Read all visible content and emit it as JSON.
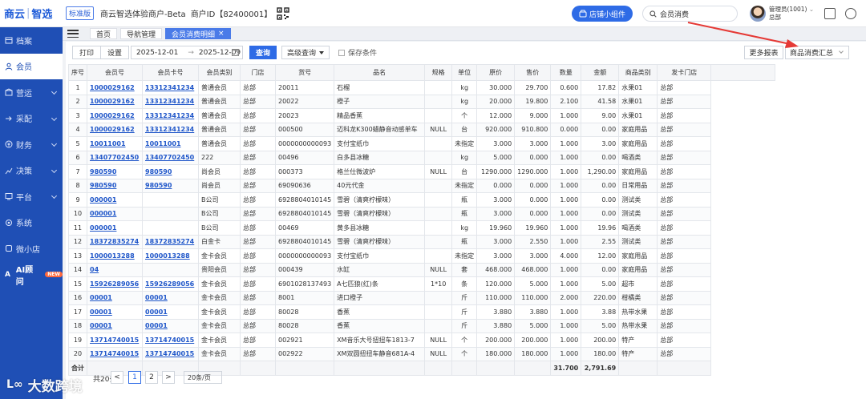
{
  "header": {
    "logo_a": "商云",
    "logo_b": "智选",
    "edition": "标准版",
    "merchant": "商云智选体验商户-Beta",
    "merchant_id": "商户ID【82400001】",
    "widget_label": "店铺小组件",
    "search_value": "会员消费",
    "user_name": "管理员(1001)",
    "user_store": "总部"
  },
  "sidebar": {
    "items": [
      {
        "label": "档案",
        "icon": "archive-icon",
        "chevron": false
      },
      {
        "label": "会员",
        "icon": "member-icon",
        "chevron": false,
        "active": true
      },
      {
        "label": "营运",
        "icon": "operation-icon",
        "chevron": true
      },
      {
        "label": "采配",
        "icon": "purchase-icon",
        "chevron": true
      },
      {
        "label": "财务",
        "icon": "finance-icon",
        "chevron": true
      },
      {
        "label": "决策",
        "icon": "decision-icon",
        "chevron": true
      },
      {
        "label": "平台",
        "icon": "platform-icon",
        "chevron": true
      },
      {
        "label": "系统",
        "icon": "system-icon",
        "chevron": false
      },
      {
        "label": "微小店",
        "icon": "mini-shop-icon",
        "chevron": false
      },
      {
        "label": "AI顾问",
        "icon": "ai-icon",
        "chevron": false,
        "badge": "NEW"
      }
    ]
  },
  "tabs": [
    {
      "label": "首页",
      "active": false,
      "closable": false
    },
    {
      "label": "导航管理",
      "active": false,
      "closable": false
    },
    {
      "label": "会员消费明细",
      "active": true,
      "closable": true
    }
  ],
  "toolbar": {
    "print": "打印",
    "settings": "设置",
    "date_from": "2025-12-01",
    "date_arrow": "→",
    "date_to": "2025-12-09",
    "query": "查询",
    "advanced": "高级查询",
    "save_condition": "保存条件",
    "more_reports": "更多报表",
    "report_select": "商品消费汇总"
  },
  "table": {
    "columns": [
      "序号",
      "会员号",
      "会员卡号",
      "会员类别",
      "门店",
      "货号",
      "品名",
      "规格",
      "单位",
      "原价",
      "售价",
      "数量",
      "金额",
      "商品类别",
      "发卡门店"
    ],
    "rows": [
      [
        "1",
        "1000029162",
        "13312341234",
        "普通会员",
        "总部",
        "20011",
        "石榴",
        "",
        "kg",
        "30.000",
        "29.700",
        "0.600",
        "17.82",
        "水果01",
        "总部"
      ],
      [
        "2",
        "1000029162",
        "13312341234",
        "普通会员",
        "总部",
        "20022",
        "橙子",
        "",
        "kg",
        "20.000",
        "19.800",
        "2.100",
        "41.58",
        "水果01",
        "总部"
      ],
      [
        "3",
        "1000029162",
        "13312341234",
        "普通会员",
        "总部",
        "20023",
        "精品香蕉",
        "",
        "个",
        "12.000",
        "9.000",
        "1.000",
        "9.00",
        "水果01",
        "总部"
      ],
      [
        "4",
        "1000029162",
        "13312341234",
        "普通会员",
        "总部",
        "000500",
        "迈科龙K300蜡静音动感单车",
        "NULL",
        "台",
        "920.000",
        "910.800",
        "0.000",
        "0.00",
        "家庭用品",
        "总部"
      ],
      [
        "5",
        "10011001",
        "10011001",
        "普通会员",
        "总部",
        "0000000000093",
        "支付宝纸巾",
        "",
        "未指定",
        "3.000",
        "3.000",
        "1.000",
        "3.00",
        "家庭用品",
        "总部"
      ],
      [
        "6",
        "13407702450",
        "13407702450",
        "222",
        "总部",
        "00496",
        "白多县冰糖",
        "",
        "kg",
        "5.000",
        "0.000",
        "1.000",
        "0.00",
        "喝酒类",
        "总部"
      ],
      [
        "7",
        "980590",
        "980590",
        "尚会员",
        "总部",
        "000373",
        "格兰仕微波炉",
        "NULL",
        "台",
        "1290.000",
        "1290.000",
        "1.000",
        "1,290.00",
        "家庭用品",
        "总部"
      ],
      [
        "8",
        "980590",
        "980590",
        "尚会员",
        "总部",
        "69090636",
        "40元代金",
        "",
        "未指定",
        "0.000",
        "0.000",
        "1.000",
        "0.00",
        "日常用品",
        "总部"
      ],
      [
        "9",
        "000001",
        "",
        "B公司",
        "总部",
        "6928804010145",
        "雪碧（清爽柠檬味）",
        "",
        "瓶",
        "3.000",
        "0.000",
        "1.000",
        "0.00",
        "测试类",
        "总部"
      ],
      [
        "10",
        "000001",
        "",
        "B公司",
        "总部",
        "6928804010145",
        "雪碧（清爽柠檬味）",
        "",
        "瓶",
        "3.000",
        "0.000",
        "1.000",
        "0.00",
        "测试类",
        "总部"
      ],
      [
        "11",
        "000001",
        "",
        "B公司",
        "总部",
        "00469",
        "黄多县冰糖",
        "",
        "kg",
        "19.960",
        "19.960",
        "1.000",
        "19.96",
        "喝酒类",
        "总部"
      ],
      [
        "12",
        "18372835274",
        "18372835274",
        "白金卡",
        "总部",
        "6928804010145",
        "雪碧（清爽柠檬味）",
        "",
        "瓶",
        "3.000",
        "2.550",
        "1.000",
        "2.55",
        "测试类",
        "总部"
      ],
      [
        "13",
        "1000013288",
        "1000013288",
        "金卡会员",
        "总部",
        "0000000000093",
        "支付宝纸巾",
        "",
        "未指定",
        "3.000",
        "3.000",
        "4.000",
        "12.00",
        "家庭用品",
        "总部"
      ],
      [
        "14",
        "04",
        "",
        "贵阳会员",
        "总部",
        "000439",
        "水缸",
        "NULL",
        "套",
        "468.000",
        "468.000",
        "1.000",
        "0.00",
        "家庭用品",
        "总部"
      ],
      [
        "15",
        "15926289056",
        "15926289056",
        "金卡会员",
        "总部",
        "6901028137493",
        "A七匹狼(红)条",
        "1*10",
        "条",
        "120.000",
        "5.000",
        "1.000",
        "5.00",
        "超市",
        "总部"
      ],
      [
        "16",
        "00001",
        "00001",
        "金卡会员",
        "总部",
        "8001",
        "进口橙子",
        "",
        "斤",
        "110.000",
        "110.000",
        "2.000",
        "220.00",
        "柑橘类",
        "总部"
      ],
      [
        "17",
        "00001",
        "00001",
        "金卡会员",
        "总部",
        "80028",
        "香蕉",
        "",
        "斤",
        "3.880",
        "3.880",
        "1.000",
        "3.88",
        "热带水果",
        "总部"
      ],
      [
        "18",
        "00001",
        "00001",
        "金卡会员",
        "总部",
        "80028",
        "香蕉",
        "",
        "斤",
        "3.880",
        "5.000",
        "1.000",
        "5.00",
        "热带水果",
        "总部"
      ],
      [
        "19",
        "13714740015",
        "13714740015",
        "金卡会员",
        "总部",
        "002921",
        "XM音乐大号扭扭车1813-7",
        "NULL",
        "个",
        "200.000",
        "200.000",
        "1.000",
        "200.00",
        "特产",
        "总部"
      ],
      [
        "20",
        "13714740015",
        "13714740015",
        "金卡会员",
        "总部",
        "002922",
        "XM双圆扭扭车静音681A-4",
        "NULL",
        "个",
        "180.000",
        "180.000",
        "1.000",
        "180.00",
        "特产",
        "总部"
      ]
    ],
    "total_label": "合计",
    "total_qty": "31.700",
    "total_amount": "2,791.69"
  },
  "pager": {
    "total": "共20条",
    "prev": "<",
    "page1": "1",
    "page2": "2",
    "next": ">",
    "page_size": "20条/页"
  },
  "watermark": {
    "mark": "大数跨境",
    "logo": "L∞"
  },
  "colors": {
    "brand_blue": "#1f4fb5",
    "accent_blue": "#2e6be6",
    "link_blue": "#1f56c9",
    "annotation_red": "#e53935"
  }
}
